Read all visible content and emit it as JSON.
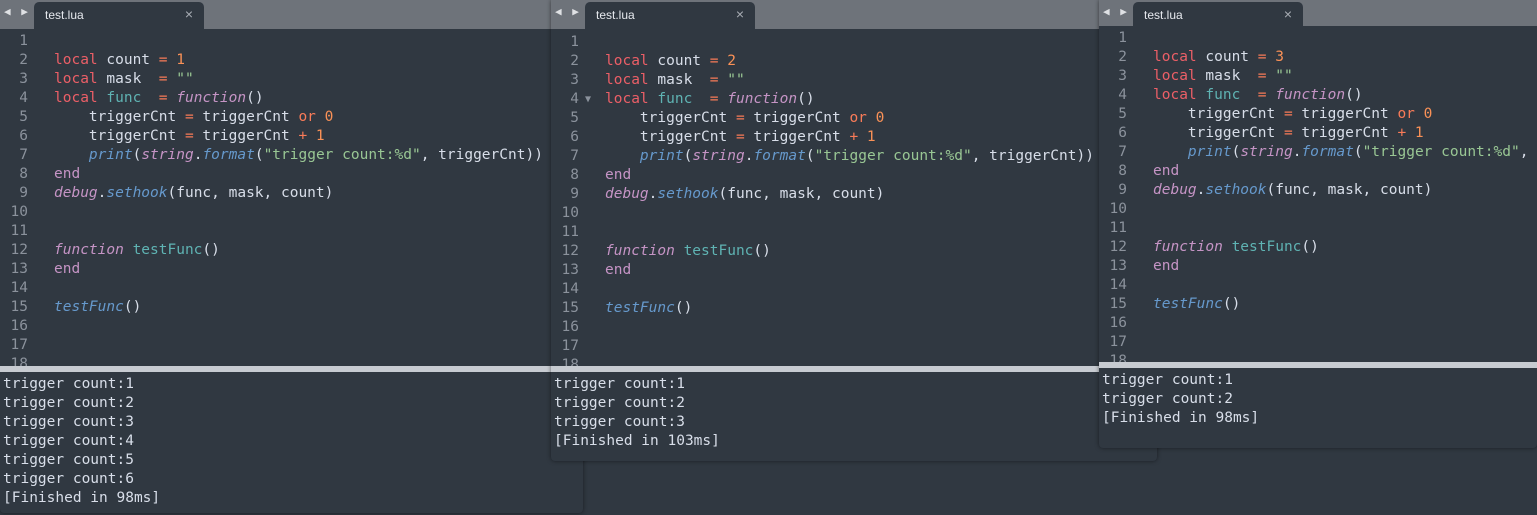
{
  "colors": {
    "background": "#303841",
    "tabbar": "#6e737a",
    "keyword": "#ec5f67",
    "number": "#f99157",
    "string": "#99c794",
    "function_name": "#5fb3b3",
    "italic_keyword": "#c594c5",
    "call": "#6699cc"
  },
  "windows": [
    {
      "tab": "test.lua",
      "nav": "◀ ▶",
      "close": "×",
      "code": [
        [],
        [
          [
            "local",
            "kw"
          ],
          [
            " count ",
            "pl"
          ],
          [
            "=",
            "op"
          ],
          [
            " ",
            "pl"
          ],
          [
            "1",
            "num"
          ]
        ],
        [
          [
            "local",
            "kw"
          ],
          [
            " mask  ",
            "pl"
          ],
          [
            "=",
            "op"
          ],
          [
            " ",
            "pl"
          ],
          [
            "\"\"",
            "str"
          ]
        ],
        [
          [
            "local",
            "kw"
          ],
          [
            " ",
            "pl"
          ],
          [
            "func",
            "fn"
          ],
          [
            "  ",
            "pl"
          ],
          [
            "=",
            "op"
          ],
          [
            " ",
            "pl"
          ],
          [
            "function",
            "fk"
          ],
          [
            "()",
            "pl"
          ]
        ],
        [
          [
            "    triggerCnt ",
            "pl"
          ],
          [
            "=",
            "op"
          ],
          [
            " triggerCnt ",
            "pl"
          ],
          [
            "or",
            "op"
          ],
          [
            " ",
            "pl"
          ],
          [
            "0",
            "num"
          ]
        ],
        [
          [
            "    triggerCnt ",
            "pl"
          ],
          [
            "=",
            "op"
          ],
          [
            " triggerCnt ",
            "pl"
          ],
          [
            "+",
            "op"
          ],
          [
            " ",
            "pl"
          ],
          [
            "1",
            "num"
          ]
        ],
        [
          [
            "    ",
            "pl"
          ],
          [
            "print",
            "call"
          ],
          [
            "(",
            "pl"
          ],
          [
            "string",
            "lib"
          ],
          [
            ".",
            "pl"
          ],
          [
            "format",
            "call"
          ],
          [
            "(",
            "pl"
          ],
          [
            "\"trigger count:%d\"",
            "str"
          ],
          [
            ", triggerCnt))",
            "pl"
          ]
        ],
        [
          [
            "end",
            "endk"
          ]
        ],
        [
          [
            "debug",
            "lib"
          ],
          [
            ".",
            "pl"
          ],
          [
            "sethook",
            "call"
          ],
          [
            "(func, mask, count)",
            "pl"
          ]
        ],
        [],
        [],
        [
          [
            "function",
            "fk"
          ],
          [
            " ",
            "pl"
          ],
          [
            "testFunc",
            "fn"
          ],
          [
            "()",
            "pl"
          ]
        ],
        [
          [
            "end",
            "endk"
          ]
        ],
        [],
        [
          [
            "testFunc",
            "call"
          ],
          [
            "()",
            "pl"
          ]
        ],
        [],
        [],
        []
      ],
      "output": [
        "trigger count:1",
        "trigger count:2",
        "trigger count:3",
        "trigger count:4",
        "trigger count:5",
        "trigger count:6",
        "[Finished in 98ms]"
      ]
    },
    {
      "tab": "test.lua",
      "nav": "◀ ▶",
      "close": "×",
      "fold_marker": "▼",
      "code": [
        [],
        [
          [
            "local",
            "kw"
          ],
          [
            " count ",
            "pl"
          ],
          [
            "=",
            "op"
          ],
          [
            " ",
            "pl"
          ],
          [
            "2",
            "num"
          ]
        ],
        [
          [
            "local",
            "kw"
          ],
          [
            " mask  ",
            "pl"
          ],
          [
            "=",
            "op"
          ],
          [
            " ",
            "pl"
          ],
          [
            "\"\"",
            "str"
          ]
        ],
        [
          [
            "local",
            "kw"
          ],
          [
            " ",
            "pl"
          ],
          [
            "func",
            "fn"
          ],
          [
            "  ",
            "pl"
          ],
          [
            "=",
            "op"
          ],
          [
            " ",
            "pl"
          ],
          [
            "function",
            "fk"
          ],
          [
            "()",
            "pl"
          ]
        ],
        [
          [
            "    triggerCnt ",
            "pl"
          ],
          [
            "=",
            "op"
          ],
          [
            " triggerCnt ",
            "pl"
          ],
          [
            "or",
            "op"
          ],
          [
            " ",
            "pl"
          ],
          [
            "0",
            "num"
          ]
        ],
        [
          [
            "    triggerCnt ",
            "pl"
          ],
          [
            "=",
            "op"
          ],
          [
            " triggerCnt ",
            "pl"
          ],
          [
            "+",
            "op"
          ],
          [
            " ",
            "pl"
          ],
          [
            "1",
            "num"
          ]
        ],
        [
          [
            "    ",
            "pl"
          ],
          [
            "print",
            "call"
          ],
          [
            "(",
            "pl"
          ],
          [
            "string",
            "lib"
          ],
          [
            ".",
            "pl"
          ],
          [
            "format",
            "call"
          ],
          [
            "(",
            "pl"
          ],
          [
            "\"trigger count:%d\"",
            "str"
          ],
          [
            ", triggerCnt))",
            "pl"
          ]
        ],
        [
          [
            "end",
            "endk"
          ]
        ],
        [
          [
            "debug",
            "lib"
          ],
          [
            ".",
            "pl"
          ],
          [
            "sethook",
            "call"
          ],
          [
            "(func, mask, count)",
            "pl"
          ]
        ],
        [],
        [],
        [
          [
            "function",
            "fk"
          ],
          [
            " ",
            "pl"
          ],
          [
            "testFunc",
            "fn"
          ],
          [
            "()",
            "pl"
          ]
        ],
        [
          [
            "end",
            "endk"
          ]
        ],
        [],
        [
          [
            "testFunc",
            "call"
          ],
          [
            "()",
            "pl"
          ]
        ],
        [],
        [],
        []
      ],
      "output": [
        "trigger count:1",
        "trigger count:2",
        "trigger count:3",
        "[Finished in 103ms]"
      ]
    },
    {
      "tab": "test.lua",
      "nav": "◀ ▶",
      "close": "×",
      "code": [
        [],
        [
          [
            "local",
            "kw"
          ],
          [
            " count ",
            "pl"
          ],
          [
            "=",
            "op"
          ],
          [
            " ",
            "pl"
          ],
          [
            "3",
            "num"
          ]
        ],
        [
          [
            "local",
            "kw"
          ],
          [
            " mask  ",
            "pl"
          ],
          [
            "=",
            "op"
          ],
          [
            " ",
            "pl"
          ],
          [
            "\"\"",
            "str"
          ]
        ],
        [
          [
            "local",
            "kw"
          ],
          [
            " ",
            "pl"
          ],
          [
            "func",
            "fn"
          ],
          [
            "  ",
            "pl"
          ],
          [
            "=",
            "op"
          ],
          [
            " ",
            "pl"
          ],
          [
            "function",
            "fk"
          ],
          [
            "()",
            "pl"
          ]
        ],
        [
          [
            "    triggerCnt ",
            "pl"
          ],
          [
            "=",
            "op"
          ],
          [
            " triggerCnt ",
            "pl"
          ],
          [
            "or",
            "op"
          ],
          [
            " ",
            "pl"
          ],
          [
            "0",
            "num"
          ]
        ],
        [
          [
            "    triggerCnt ",
            "pl"
          ],
          [
            "=",
            "op"
          ],
          [
            " triggerCnt ",
            "pl"
          ],
          [
            "+",
            "op"
          ],
          [
            " ",
            "pl"
          ],
          [
            "1",
            "num"
          ]
        ],
        [
          [
            "    ",
            "pl"
          ],
          [
            "print",
            "call"
          ],
          [
            "(",
            "pl"
          ],
          [
            "string",
            "lib"
          ],
          [
            ".",
            "pl"
          ],
          [
            "format",
            "call"
          ],
          [
            "(",
            "pl"
          ],
          [
            "\"trigger count:%d\"",
            "str"
          ],
          [
            ", triggerCnt))",
            "pl"
          ]
        ],
        [
          [
            "end",
            "endk"
          ]
        ],
        [
          [
            "debug",
            "lib"
          ],
          [
            ".",
            "pl"
          ],
          [
            "sethook",
            "call"
          ],
          [
            "(func, mask, count)",
            "pl"
          ]
        ],
        [],
        [],
        [
          [
            "function",
            "fk"
          ],
          [
            " ",
            "pl"
          ],
          [
            "testFunc",
            "fn"
          ],
          [
            "()",
            "pl"
          ]
        ],
        [
          [
            "end",
            "endk"
          ]
        ],
        [],
        [
          [
            "testFunc",
            "call"
          ],
          [
            "()",
            "pl"
          ]
        ],
        [],
        [],
        []
      ],
      "output": [
        "trigger count:1",
        "trigger count:2",
        "[Finished in 98ms]"
      ]
    }
  ]
}
